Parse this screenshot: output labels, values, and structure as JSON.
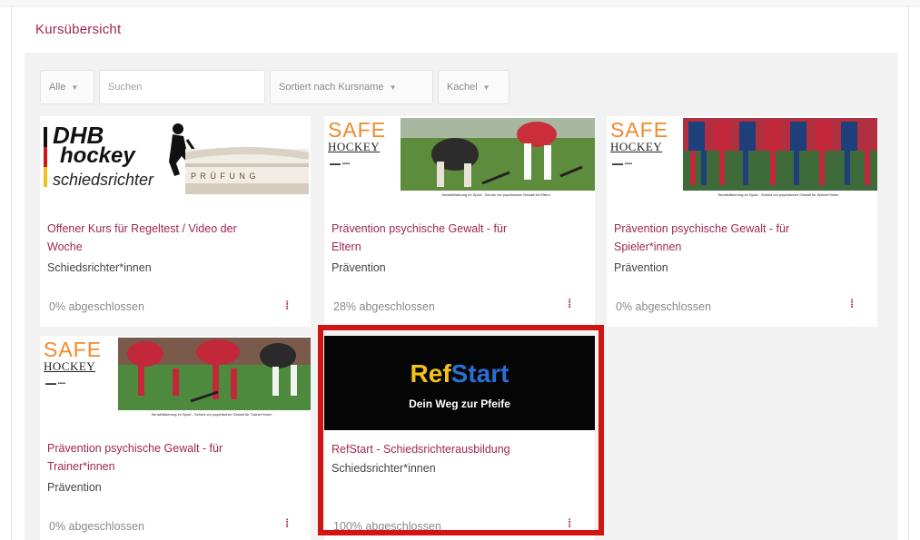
{
  "page": {
    "title": "Kursübersicht"
  },
  "filters": {
    "status": "Alle",
    "search_placeholder": "Suchen",
    "sort": "Sortiert nach Kursname",
    "view": "Kachel"
  },
  "courses": [
    {
      "title_line1": "Offener Kurs für Regeltest / Video der",
      "title_line2": "Woche",
      "category": "Schiedsrichter*innen",
      "progress": "0% abgeschlossen",
      "image": {
        "line1": "DHB",
        "line2": "hockey",
        "line3": "schiedsrichter",
        "book_text": "P R Ü F U N G"
      }
    },
    {
      "title_line1": "Prävention psychische Gewalt - für",
      "title_line2": "Eltern",
      "category": "Prävention",
      "progress": "28% abgeschlossen",
      "image": {
        "safe": "SAFE",
        "hockey": "HOCKEY",
        "caption": "Sensibilisierung im Sport - Schutz vor psychischer Gewalt für Eltern"
      }
    },
    {
      "title_line1": "Prävention psychische Gewalt - für",
      "title_line2": "Spieler*innen",
      "category": "Prävention",
      "progress": "0% abgeschlossen",
      "image": {
        "safe": "SAFE",
        "hockey": "HOCKEY",
        "caption": "Sensibilisierung im Sport - Schutz vor psychischer Gewalt für Spieler*innen"
      }
    },
    {
      "title_line1": "Prävention psychische Gewalt - für",
      "title_line2": "Trainer*innen",
      "category": "Prävention",
      "progress": "0% abgeschlossen",
      "image": {
        "safe": "SAFE",
        "hockey": "HOCKEY",
        "caption": "Sensibilisierung im Sport - Schutz vor psychischer Gewalt für Trainer*innen"
      }
    },
    {
      "title_line1": "RefStart - Schiedsrichterausbildung",
      "title_line2": "",
      "category": "Schiedsrichter*innen",
      "progress": "100% abgeschlossen",
      "image": {
        "ref": "Ref",
        "start": "Start",
        "tagline": "Dein Weg zur Pfeife"
      }
    }
  ],
  "icons": {
    "menu": "kebab-menu-icon",
    "caret": "caret-down-icon"
  },
  "colors": {
    "accent": "#a0284a",
    "safe_orange": "#f08a2a",
    "ref_yellow": "#f2c21a",
    "start_blue": "#2a6fd6",
    "highlight": "#d11515"
  }
}
